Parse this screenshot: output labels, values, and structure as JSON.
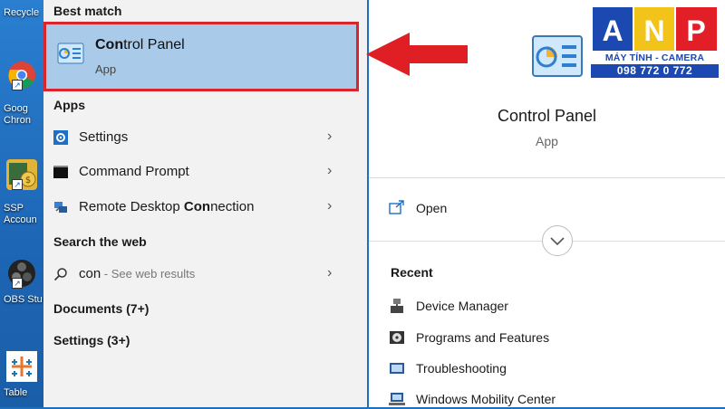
{
  "desktop": {
    "icons": [
      {
        "label": "Recycle"
      },
      {
        "label": "Goog\nChron"
      },
      {
        "label": "SSP\nAccoun"
      },
      {
        "label": "OBS Stu"
      },
      {
        "label": "Table"
      }
    ]
  },
  "results": {
    "best_match_heading": "Best match",
    "best_match": {
      "title_prefix": "Con",
      "title_rest": "trol Panel",
      "subtitle": "App"
    },
    "apps_heading": "Apps",
    "apps": [
      {
        "label": "Settings"
      },
      {
        "label": "Command Prompt"
      },
      {
        "label_prefix": "Remote Desktop ",
        "label_bold": "Con",
        "label_rest": "nection"
      }
    ],
    "web_heading": "Search the web",
    "web_item": {
      "query": "con",
      "suffix": " - See web results"
    },
    "documents_heading": "Documents (7+)",
    "settings_heading": "Settings (3+)"
  },
  "detail": {
    "title": "Control Panel",
    "subtitle": "App",
    "open_label": "Open",
    "recent_heading": "Recent",
    "recent": [
      {
        "label": "Device Manager",
        "icon": "device-manager-icon"
      },
      {
        "label": "Programs and Features",
        "icon": "programs-icon"
      },
      {
        "label": "Troubleshooting",
        "icon": "troubleshooting-icon"
      },
      {
        "label": "Windows Mobility Center",
        "icon": "mobility-icon"
      }
    ]
  },
  "logo": {
    "letters": [
      "A",
      "N",
      "P"
    ],
    "tagline": "MÁY TÍNH - CAMERA",
    "phone": "098 772 0 772"
  },
  "colors": {
    "highlight": "#a9cbe9",
    "callout_red": "#d9252b",
    "brand_blue": "#1b49b1",
    "brand_yellow": "#f2c318",
    "brand_red": "#e21f26"
  }
}
